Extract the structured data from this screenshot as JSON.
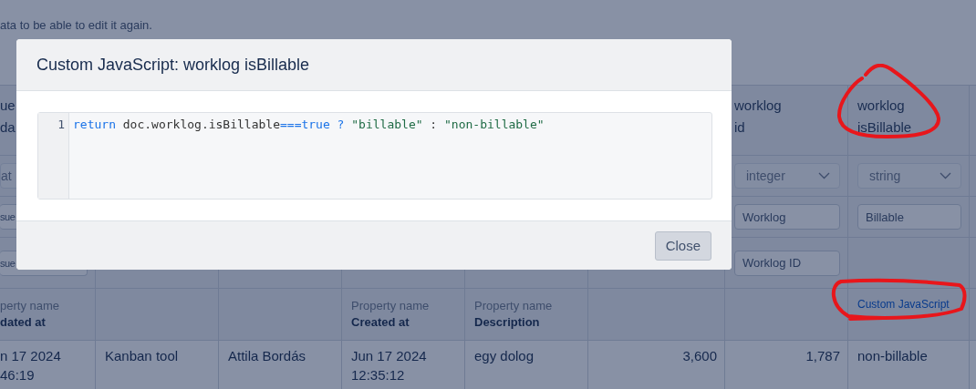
{
  "notice": "ata to be able to edit it again.",
  "table": {
    "columns": [
      {
        "kind": "text",
        "header": [
          "ue",
          "da"
        ],
        "type_select": "at",
        "field": "sue",
        "field_2": "sue",
        "property_label": "perty name",
        "property_name": "dated at",
        "value": [
          "n 17 2024",
          "46:19"
        ]
      },
      {
        "kind": "text",
        "value": [
          "Kanban tool"
        ]
      },
      {
        "kind": "text",
        "value": [
          "Attila Bordás"
        ]
      },
      {
        "kind": "text",
        "property_label": "Property name",
        "property_name": "Created at",
        "value": [
          "Jun 17 2024",
          "12:35:12"
        ]
      },
      {
        "kind": "text",
        "property_label": "Property name",
        "property_name": "Description",
        "value": [
          "egy dolog"
        ]
      },
      {
        "kind": "number",
        "value": [
          "3,600"
        ]
      },
      {
        "kind": "number",
        "header": [
          "worklog",
          "id"
        ],
        "type_select": "integer",
        "field": "Worklog",
        "field_2": "Worklog ID",
        "value": [
          "1,787"
        ]
      },
      {
        "kind": "text",
        "header": [
          "worklog",
          "isBillable"
        ],
        "type_select": "string",
        "field": "Billable",
        "link": "Custom JavaScript",
        "value": [
          "non-billable"
        ]
      }
    ]
  },
  "modal": {
    "title": "Custom JavaScript: worklog isBillable",
    "code_lines": [
      {
        "number": "1",
        "tokens": [
          {
            "kind": "keyword",
            "text": "return"
          },
          {
            "kind": "plain",
            "text": " doc.worklog.isBillable"
          },
          {
            "kind": "keyword",
            "text": "===true ? "
          },
          {
            "kind": "string",
            "text": "\"billable\""
          },
          {
            "kind": "plain",
            "text": " : "
          },
          {
            "kind": "string",
            "text": "\"non-billable\""
          }
        ]
      }
    ],
    "buttons": [
      "Close"
    ]
  }
}
